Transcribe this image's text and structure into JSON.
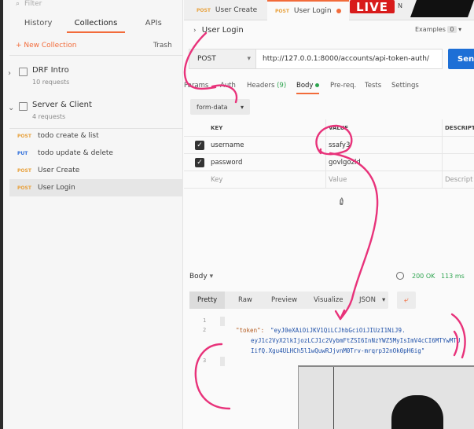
{
  "sidebar": {
    "filter_placeholder": "Filter",
    "tabs": [
      {
        "label": "History"
      },
      {
        "label": "Collections"
      },
      {
        "label": "APIs"
      }
    ],
    "new_collection": "+ New Collection",
    "trash": "Trash",
    "collections": [
      {
        "name": "DRF Intro",
        "count": "10 requests",
        "expanded": false
      },
      {
        "name": "Server & Client",
        "count": "4 requests",
        "expanded": true
      }
    ],
    "requests": [
      {
        "method": "POST",
        "name": "todo create & list"
      },
      {
        "method": "PUT",
        "name": "todo update & delete"
      },
      {
        "method": "POST",
        "name": "User Create"
      },
      {
        "method": "POST",
        "name": "User Login",
        "selected": true
      }
    ]
  },
  "tabs": [
    {
      "method": "POST",
      "name": "User Create"
    },
    {
      "method": "POST",
      "name": "User Login",
      "active": true
    }
  ],
  "live_badge": "LIVE",
  "live_side_text": "N",
  "request": {
    "title": "User Login",
    "examples_label": "Examples",
    "examples_count": "0",
    "method": "POST",
    "url": "http://127.0.0.1:8000/accounts/api-token-auth/",
    "send_label": "Send",
    "subtabs": [
      {
        "label": "Params"
      },
      {
        "label": "Auth"
      },
      {
        "label": "Headers",
        "badge": "(9)"
      },
      {
        "label": "Body",
        "active": true
      },
      {
        "label": "Pre-req."
      },
      {
        "label": "Tests"
      },
      {
        "label": "Settings"
      }
    ],
    "body_mode": "form-data",
    "table": {
      "headers": [
        "KEY",
        "VALUE",
        "DESCRIPTI"
      ],
      "rows": [
        {
          "key": "username",
          "value": "ssafy3",
          "checked": true
        },
        {
          "key": "password",
          "value": "govlgozld",
          "checked": true
        }
      ],
      "placeholder": {
        "key": "Key",
        "value": "Value",
        "description": "Descript"
      }
    }
  },
  "response": {
    "label": "Body",
    "status": "200 OK",
    "time": "113 ms",
    "view_tabs": [
      {
        "label": "Pretty",
        "active": true
      },
      {
        "label": "Raw"
      },
      {
        "label": "Preview"
      },
      {
        "label": "Visualize"
      },
      {
        "label": "JSON"
      }
    ],
    "code": {
      "line_numbers": [
        "1",
        "2",
        "3"
      ],
      "key": "\"token\":",
      "value_lines": [
        "\"eyJ0eXAiOiJKV1QiLCJhbGciOiJIUzI1NiJ9.",
        "eyJ1c2VyX2lkIjozLCJ1c2VybmFtZSI6InNzYWZ5MyIsImV4cCI6MTYwMTU",
        "IifQ.Xgu4ULHCh5l1wQuwRJjvnM0Trv-mrqrp32nOk0pH6ig\""
      ]
    }
  },
  "colors": {
    "accent": "#f26b3a",
    "send": "#1d6fd6",
    "live": "#d81b1b",
    "status_ok": "#2ea44f",
    "ink": "#e8327a"
  }
}
